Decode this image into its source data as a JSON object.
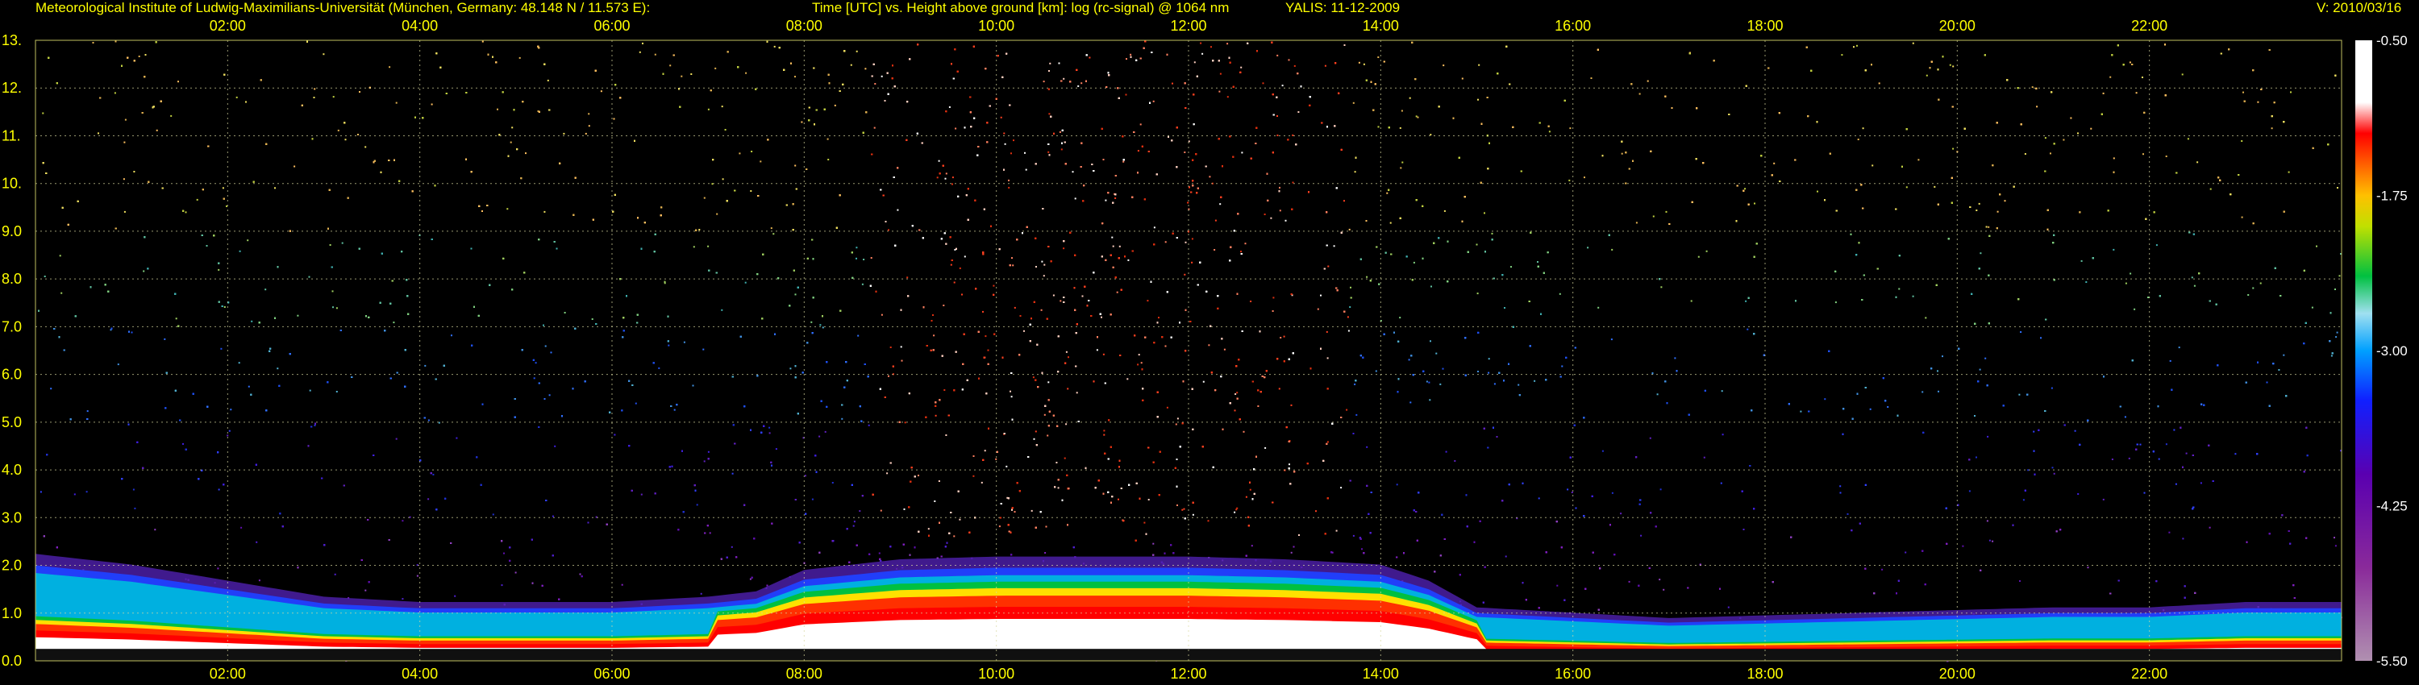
{
  "header": {
    "institute": "Meteorological Institute of Ludwig-Maximilians-Universität (München, Germany: 48.148 N / 11.573 E):",
    "axes_title": "Time [UTC] vs. Height above ground [km]: log (rc-signal) @ 1064 nm",
    "instrument": "YALIS: 11-12-2009",
    "version": "V: 2010/03/16"
  },
  "colors": {
    "text": "#ffff00",
    "grid": "#d8d8a0",
    "background": "#000000"
  },
  "chart_data": {
    "type": "heatmap",
    "title": "Time [UTC] vs. Height above ground [km]: log (rc-signal) @ 1064 nm",
    "x": {
      "unit": "hours UTC",
      "range": [
        0,
        24
      ],
      "grid": true,
      "ticks": [
        2,
        4,
        6,
        8,
        10,
        12,
        14,
        16,
        18,
        20,
        22
      ],
      "tick_labels": [
        "02:00",
        "04:00",
        "06:00",
        "08:00",
        "10:00",
        "12:00",
        "14:00",
        "16:00",
        "18:00",
        "20:00",
        "22:00"
      ]
    },
    "y": {
      "unit": "km",
      "range": [
        0,
        13
      ],
      "grid": true,
      "ticks": [
        0,
        1,
        2,
        3,
        4,
        5,
        6,
        7,
        8,
        9,
        10,
        11,
        12,
        13
      ],
      "tick_labels": [
        "0.0",
        "1.0",
        "2.0",
        "3.0",
        "4.0",
        "5.0",
        "6.0",
        "7.0",
        "8.0",
        "9.0",
        "10.",
        "11.",
        "12.",
        "13."
      ]
    },
    "colorbar": {
      "range": [
        -5.5,
        -0.5
      ],
      "ticks": [
        -0.5,
        -1.75,
        -3.0,
        -4.25,
        -5.5
      ],
      "tick_labels": [
        "-0.50",
        "-1.75",
        "-3.00",
        "-4.25",
        "-5.50"
      ]
    },
    "boundary_layer_top_km": [
      [
        0,
        2.0
      ],
      [
        1,
        1.8
      ],
      [
        2,
        1.5
      ],
      [
        3,
        1.2
      ],
      [
        4,
        1.1
      ],
      [
        5,
        1.1
      ],
      [
        6,
        1.1
      ],
      [
        7,
        1.2
      ],
      [
        7.5,
        1.3
      ],
      [
        8,
        1.7
      ],
      [
        9,
        1.9
      ],
      [
        10,
        1.95
      ],
      [
        11,
        1.95
      ],
      [
        12,
        1.95
      ],
      [
        13,
        1.9
      ],
      [
        14,
        1.8
      ],
      [
        14.5,
        1.5
      ],
      [
        15,
        1.0
      ],
      [
        16,
        0.9
      ],
      [
        17,
        0.8
      ],
      [
        18,
        0.85
      ],
      [
        19,
        0.9
      ],
      [
        20,
        0.95
      ],
      [
        21,
        1.0
      ],
      [
        22,
        1.0
      ],
      [
        23,
        1.1
      ],
      [
        24,
        1.1
      ]
    ],
    "noise_intensity": [
      [
        0,
        0.35
      ],
      [
        6,
        0.35
      ],
      [
        7,
        0.5
      ],
      [
        8,
        0.7
      ],
      [
        9,
        0.85
      ],
      [
        10,
        1.0
      ],
      [
        11,
        1.0
      ],
      [
        12,
        1.0
      ],
      [
        13,
        0.9
      ],
      [
        14,
        0.75
      ],
      [
        15,
        0.45
      ],
      [
        16,
        0.35
      ],
      [
        24,
        0.35
      ]
    ]
  }
}
